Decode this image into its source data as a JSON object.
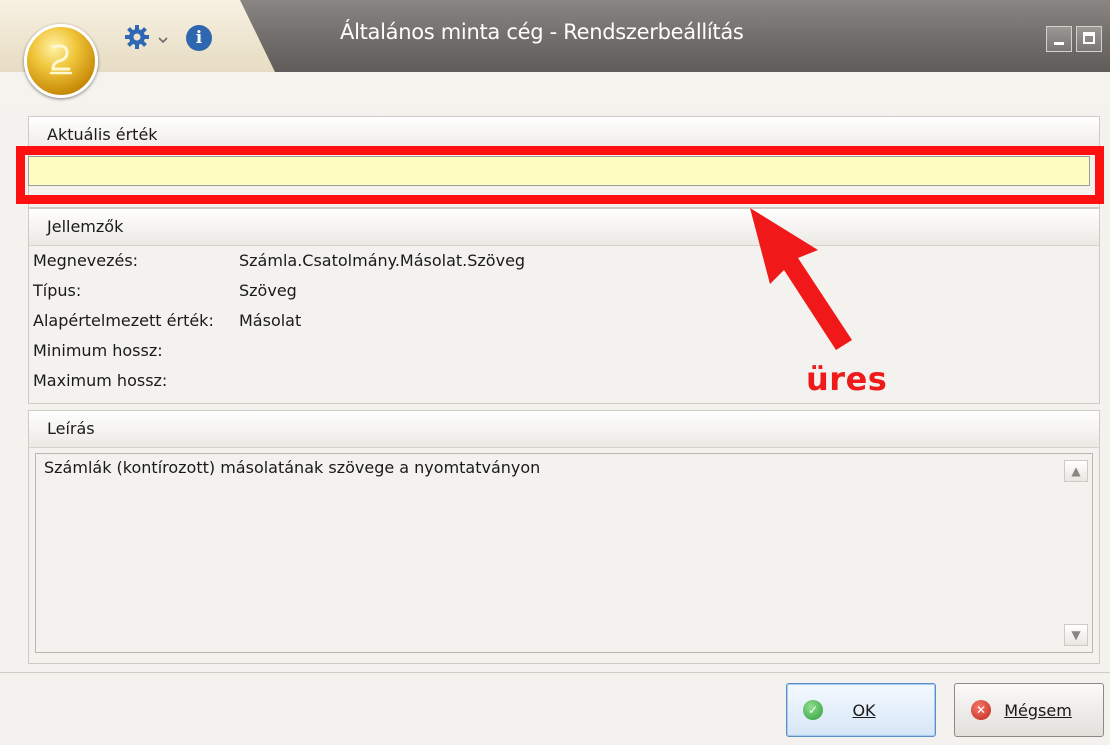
{
  "window": {
    "title": "Általános minta cég - Rendszerbeállítás",
    "icons": [
      "app-logo-icon",
      "gear-icon",
      "chevron-down-icon",
      "info-icon",
      "minimize-icon",
      "maximize-icon"
    ]
  },
  "current_value": {
    "header": "Aktuális érték",
    "value": ""
  },
  "properties": {
    "header": "Jellemzők",
    "rows": [
      {
        "label": "Megnevezés:",
        "value": "Számla.Csatolmány.Másolat.Szöveg"
      },
      {
        "label": "Típus:",
        "value": "Szöveg"
      },
      {
        "label": "Alapértelmezett érték:",
        "value": "Másolat"
      },
      {
        "label": "Minimum hossz:",
        "value": ""
      },
      {
        "label": "Maximum hossz:",
        "value": ""
      }
    ]
  },
  "description": {
    "header": "Leírás",
    "text": "Számlák (kontírozott) másolatának szövege a nyomtatványon"
  },
  "buttons": {
    "ok": "OK",
    "cancel": "Mégsem"
  },
  "annotation": {
    "text": "üres",
    "color": "#ef1a1a"
  },
  "colors": {
    "value_field_bg": "#fffdc2",
    "highlight_border": "#ff1010"
  }
}
